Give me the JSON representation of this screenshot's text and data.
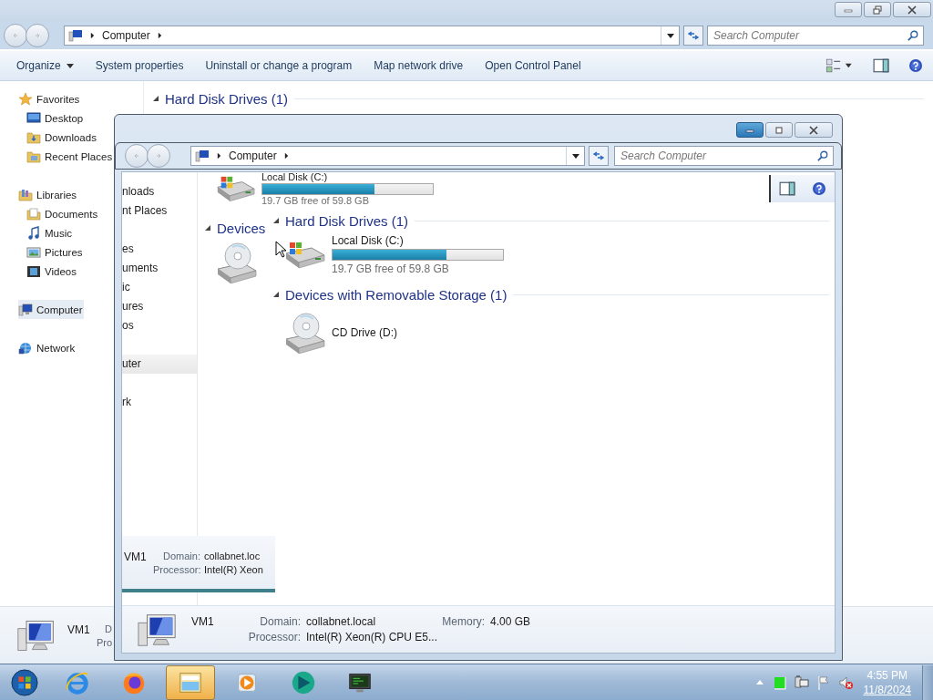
{
  "back_window": {
    "address": "Computer",
    "search": {
      "placeholder": "Search Computer"
    },
    "toolbar": [
      {
        "label": "Organize",
        "menu": true
      },
      {
        "label": "System properties",
        "menu": false
      },
      {
        "label": "Uninstall or change a program",
        "menu": false
      },
      {
        "label": "Map network drive",
        "menu": false
      },
      {
        "label": "Open Control Panel",
        "menu": false
      }
    ],
    "nav": [
      {
        "label": "Favorites",
        "kind": "star",
        "selected": false,
        "children": [
          {
            "label": "Desktop",
            "kind": "desktop",
            "selected": false
          },
          {
            "label": "Downloads",
            "kind": "downloads",
            "selected": false
          },
          {
            "label": "Recent Places",
            "kind": "recent",
            "selected": false
          }
        ]
      },
      {
        "label": "Libraries",
        "kind": "library",
        "selected": false,
        "children": [
          {
            "label": "Documents",
            "kind": "documents",
            "selected": false
          },
          {
            "label": "Music",
            "kind": "music",
            "selected": false
          },
          {
            "label": "Pictures",
            "kind": "pictures",
            "selected": false
          },
          {
            "label": "Videos",
            "kind": "videos",
            "selected": false
          }
        ]
      },
      {
        "label": "Computer",
        "kind": "computer",
        "selected": true
      },
      {
        "label": "Network",
        "kind": "network",
        "selected": false
      }
    ],
    "groups": [
      {
        "title": "Hard Disk Drives (1)"
      }
    ],
    "details": {
      "name": "VM1",
      "rows": [
        [
          {
            "label": "D"
          }
        ],
        [
          {
            "label": "Pro"
          }
        ]
      ]
    }
  },
  "front_window": {
    "address": "Computer",
    "search": {
      "placeholder": "Search Computer"
    },
    "ghost_nav": [
      {
        "items": [
          {
            "label": "nloads",
            "selected": false
          },
          {
            "label": "nt Places",
            "selected": false
          }
        ]
      },
      {
        "items": [
          {
            "label": "es",
            "selected": false
          },
          {
            "label": "uments",
            "selected": false
          },
          {
            "label": "ic",
            "selected": false
          },
          {
            "label": "ures",
            "selected": false
          },
          {
            "label": "os",
            "selected": false
          }
        ]
      },
      {
        "items": [
          {
            "label": "uter",
            "selected": true
          }
        ]
      },
      {
        "items": [
          {
            "label": "rk",
            "selected": false
          }
        ]
      }
    ],
    "ghost_drive": {
      "name": "Local Disk (C:)",
      "level": 0.66,
      "free": "19.7 GB free of 59.8 GB"
    },
    "ghost_group": "Devices",
    "groups": [
      {
        "title": "Hard Disk Drives (1)",
        "items": [
          {
            "kind": "disk",
            "name": "Local Disk (C:)",
            "level": 0.67,
            "free": "19.7 GB free of 59.8 GB"
          }
        ]
      },
      {
        "title": "Devices with Removable Storage (1)",
        "items": [
          {
            "kind": "cd",
            "name": "CD Drive (D:)"
          }
        ]
      }
    ],
    "ghost_details": {
      "name": "VM1",
      "rows": [
        [
          {
            "label": "Domain:",
            "value": "collabnet.loc"
          }
        ],
        [
          {
            "label": "Processor:",
            "value": "Intel(R) Xeon"
          }
        ]
      ]
    },
    "details": {
      "name": "VM1",
      "rows": [
        [
          {
            "label": "Domain:",
            "value": "collabnet.local"
          },
          {
            "label": "Memory:",
            "value": "4.00 GB"
          }
        ],
        [
          {
            "label": "Processor:",
            "value": "Intel(R) Xeon(R) CPU E5..."
          }
        ]
      ]
    }
  },
  "taskbar": {
    "apps": [
      {
        "kind": "start",
        "active": false
      },
      {
        "kind": "ie",
        "active": false
      },
      {
        "kind": "firefox",
        "active": false
      },
      {
        "kind": "explorer",
        "active": true
      },
      {
        "kind": "media",
        "active": false
      },
      {
        "kind": "teal",
        "active": false
      },
      {
        "kind": "monitor",
        "active": false
      }
    ],
    "tray": {
      "volume_muted": true,
      "time": "4:55 PM",
      "date": "11/8/2024"
    }
  }
}
